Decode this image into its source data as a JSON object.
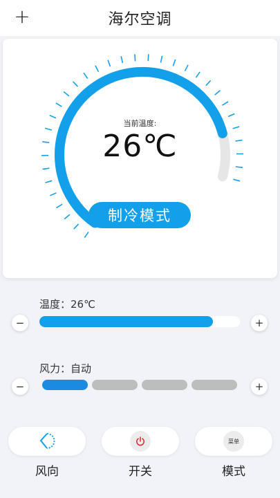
{
  "header": {
    "add_symbol": "+",
    "title": "海尔空调"
  },
  "gauge": {
    "label": "当前温度:",
    "value": "26℃",
    "fill_fraction": 0.88,
    "active_color": "#12a0ea",
    "inactive_color": "#e6e6e6"
  },
  "mode_button": {
    "label": "制冷模式"
  },
  "temperature": {
    "label": "温度：26℃",
    "minus": "−",
    "plus": "+",
    "level_fraction": 0.865
  },
  "fan": {
    "label": "风力：自动",
    "minus": "−",
    "plus": "+",
    "segments_total": 4,
    "segments_active": 1
  },
  "bottom": {
    "direction_label": "风向",
    "power_label": "开关",
    "mode_label": "模式",
    "menu_icon_text": "菜单"
  },
  "colors": {
    "accent": "#12a0ea",
    "power_red": "#d93030"
  }
}
